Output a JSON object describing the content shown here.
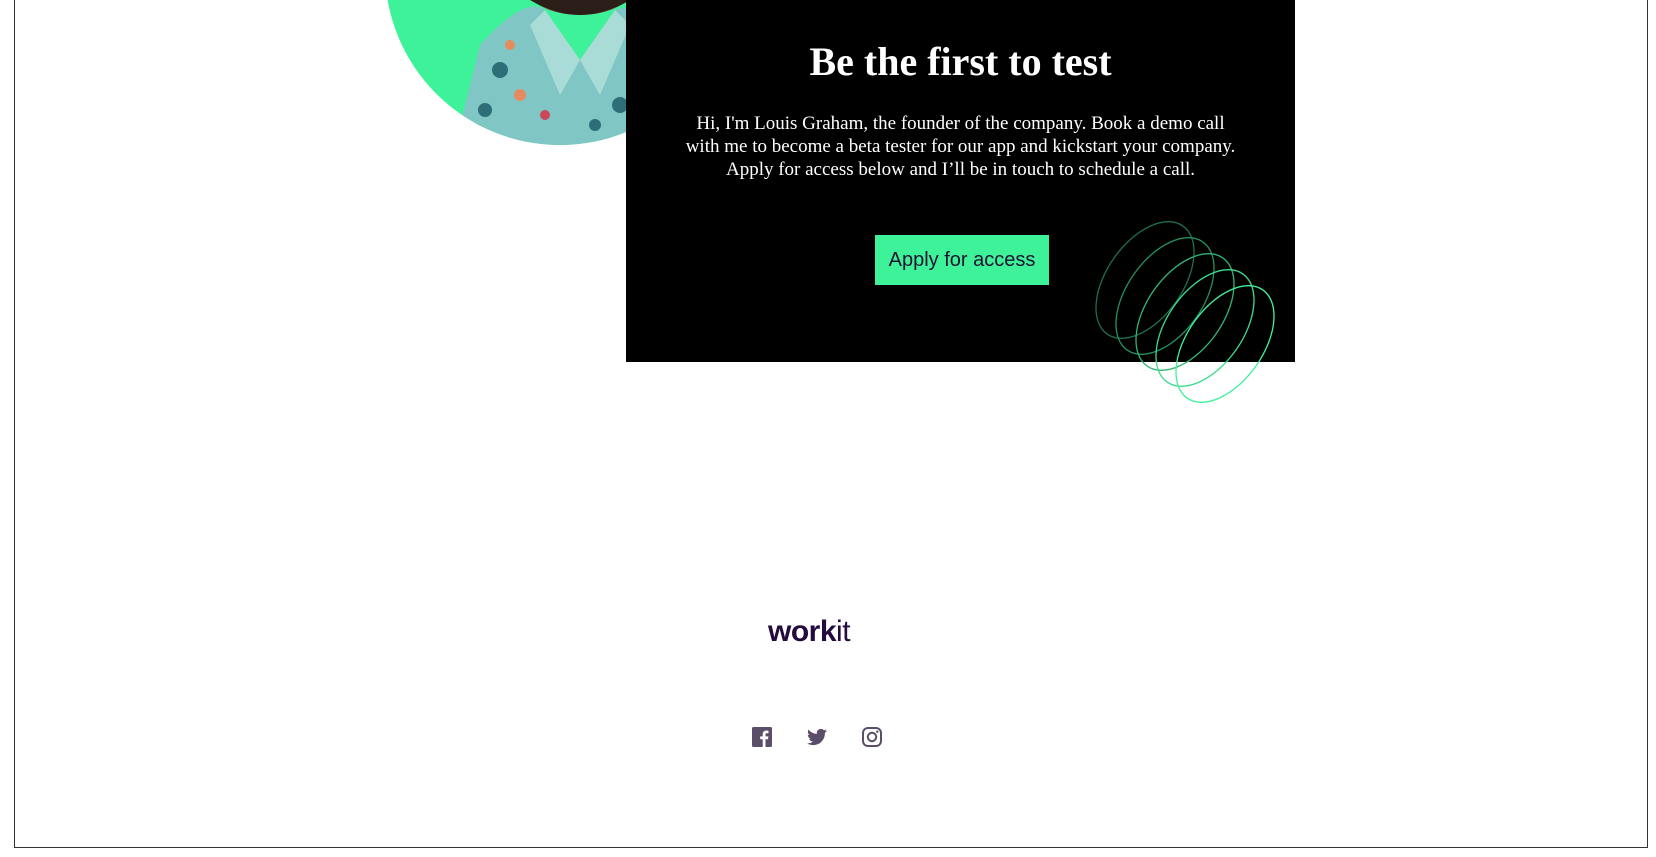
{
  "cta": {
    "title": "Be the first to test",
    "body": "Hi, I'm Louis Graham, the founder of the company. Book a demo call with me to become a beta tester for our app and kickstart your company. Apply for access below and I’ll be in touch to schedule a call.",
    "button_label": "Apply for access"
  },
  "footer": {
    "logo_bold": "work",
    "logo_light": "it",
    "social": [
      {
        "name": "facebook-icon"
      },
      {
        "name": "twitter-icon"
      },
      {
        "name": "instagram-icon"
      }
    ]
  },
  "colors": {
    "accent": "#3ef29a",
    "card_bg": "#000000",
    "brand_text": "#240a3d",
    "icon": "#5a4e68"
  }
}
